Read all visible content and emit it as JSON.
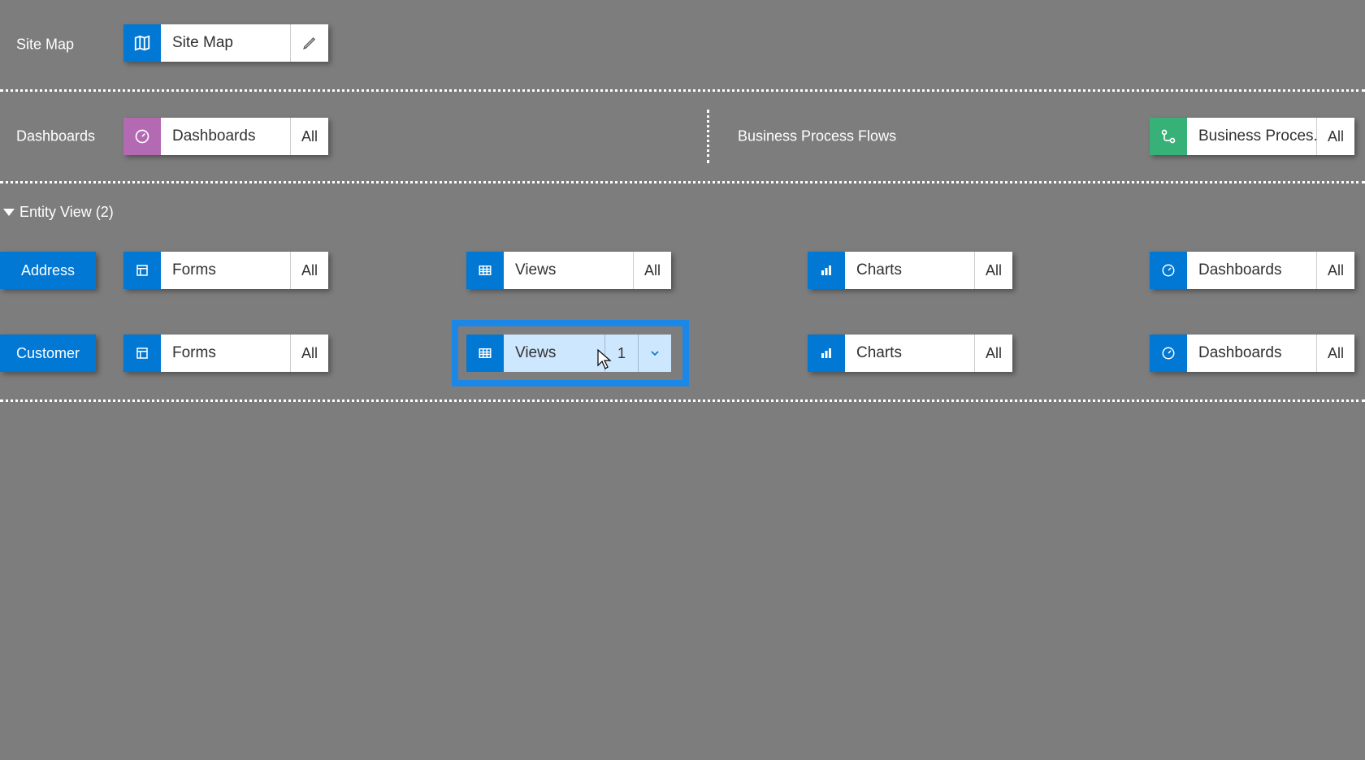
{
  "colors": {
    "blue": "#0078d4",
    "purple": "#b36ab3",
    "green": "#38b178"
  },
  "siteMap": {
    "sectionLabel": "Site Map",
    "card": {
      "label": "Site Map"
    }
  },
  "dashboards": {
    "sectionLabel": "Dashboards",
    "card": {
      "label": "Dashboards",
      "suffix": "All"
    }
  },
  "bpf": {
    "sectionLabel": "Business Process Flows",
    "card": {
      "label": "Business Proces...",
      "suffix": "All"
    }
  },
  "entityView": {
    "header": "Entity View (2)",
    "rows": [
      {
        "name": "Address",
        "items": {
          "forms": {
            "label": "Forms",
            "suffix": "All"
          },
          "views": {
            "label": "Views",
            "suffix": "All"
          },
          "charts": {
            "label": "Charts",
            "suffix": "All"
          },
          "dashboards": {
            "label": "Dashboards",
            "suffix": "All"
          }
        }
      },
      {
        "name": "Customer",
        "items": {
          "forms": {
            "label": "Forms",
            "suffix": "All"
          },
          "views": {
            "label": "Views",
            "count": "1",
            "selected": true
          },
          "charts": {
            "label": "Charts",
            "suffix": "All"
          },
          "dashboards": {
            "label": "Dashboards",
            "suffix": "All"
          }
        }
      }
    ]
  }
}
